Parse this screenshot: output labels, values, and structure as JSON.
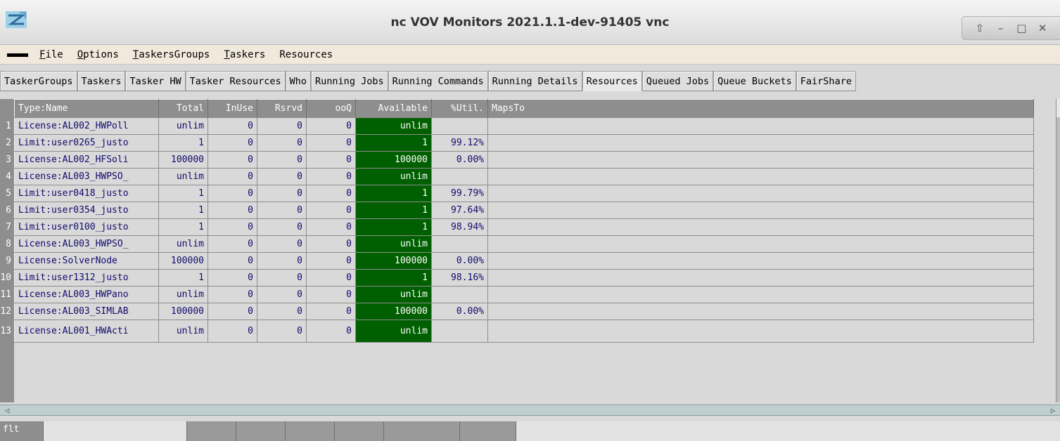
{
  "window": {
    "title": "nc VOV Monitors 2021.1.1-dev-91405 vnc",
    "controls": [
      "⇧",
      "–",
      "□",
      "✕"
    ]
  },
  "menubar": {
    "items": [
      {
        "accel": "F",
        "rest": "ile"
      },
      {
        "accel": "O",
        "rest": "ptions"
      },
      {
        "accel": "T",
        "rest": "askersGroups"
      },
      {
        "accel": "T",
        "rest": "askers"
      },
      {
        "accel": "",
        "rest": "Resources"
      }
    ]
  },
  "tabs": [
    {
      "label": "TaskerGroups",
      "active": false
    },
    {
      "label": "Taskers",
      "active": false
    },
    {
      "label": "Tasker HW",
      "active": false
    },
    {
      "label": "Tasker Resources",
      "active": false
    },
    {
      "label": "Who",
      "active": false
    },
    {
      "label": "Running Jobs",
      "active": false
    },
    {
      "label": "Running Commands",
      "active": false
    },
    {
      "label": "Running Details",
      "active": false
    },
    {
      "label": "Resources",
      "active": true
    },
    {
      "label": "Queued Jobs",
      "active": false
    },
    {
      "label": "Queue Buckets",
      "active": false
    },
    {
      "label": "FairShare",
      "active": false
    }
  ],
  "table": {
    "columns": [
      "Type:Name",
      "Total",
      "InUse",
      "Rsrvd",
      "ooQ",
      "Available",
      "%Util.",
      "MapsTo"
    ],
    "rows": [
      {
        "num": "1",
        "cells": [
          "License:AL002_HWPoll",
          "unlim",
          "0",
          "0",
          "0",
          "unlim",
          "",
          ""
        ]
      },
      {
        "num": "2",
        "cells": [
          "Limit:user0265_justo",
          "1",
          "0",
          "0",
          "0",
          "1",
          "99.12%",
          ""
        ]
      },
      {
        "num": "3",
        "cells": [
          "License:AL002_HFSoli",
          "100000",
          "0",
          "0",
          "0",
          "100000",
          "0.00%",
          ""
        ]
      },
      {
        "num": "4",
        "cells": [
          "License:AL003_HWPSO_",
          "unlim",
          "0",
          "0",
          "0",
          "unlim",
          "",
          ""
        ]
      },
      {
        "num": "5",
        "cells": [
          "Limit:user0418_justo",
          "1",
          "0",
          "0",
          "0",
          "1",
          "99.79%",
          ""
        ]
      },
      {
        "num": "6",
        "cells": [
          "Limit:user0354_justo",
          "1",
          "0",
          "0",
          "0",
          "1",
          "97.64%",
          ""
        ]
      },
      {
        "num": "7",
        "cells": [
          "Limit:user0100_justo",
          "1",
          "0",
          "0",
          "0",
          "1",
          "98.94%",
          ""
        ]
      },
      {
        "num": "8",
        "cells": [
          "License:AL003_HWPSO_",
          "unlim",
          "0",
          "0",
          "0",
          "unlim",
          "",
          ""
        ]
      },
      {
        "num": "9",
        "cells": [
          "License:SolverNode",
          "100000",
          "0",
          "0",
          "0",
          "100000",
          "0.00%",
          ""
        ]
      },
      {
        "num": "10",
        "cells": [
          "Limit:user1312_justo",
          "1",
          "0",
          "0",
          "0",
          "1",
          "98.16%",
          ""
        ]
      },
      {
        "num": "11",
        "cells": [
          "License:AL003_HWPano",
          "unlim",
          "0",
          "0",
          "0",
          "unlim",
          "",
          ""
        ]
      },
      {
        "num": "12",
        "cells": [
          "License:AL003_SIMLAB",
          "100000",
          "0",
          "0",
          "0",
          "100000",
          "0.00%",
          ""
        ]
      },
      {
        "num": "13",
        "cells": [
          "License:AL001_HWActi",
          "unlim",
          "0",
          "0",
          "0",
          "unlim",
          "",
          ""
        ]
      }
    ]
  },
  "filter": {
    "label": "flt"
  },
  "colors": {
    "available_bg": "#005f00",
    "cell_text": "#120a6b",
    "header_bg": "#8e8e8e"
  }
}
